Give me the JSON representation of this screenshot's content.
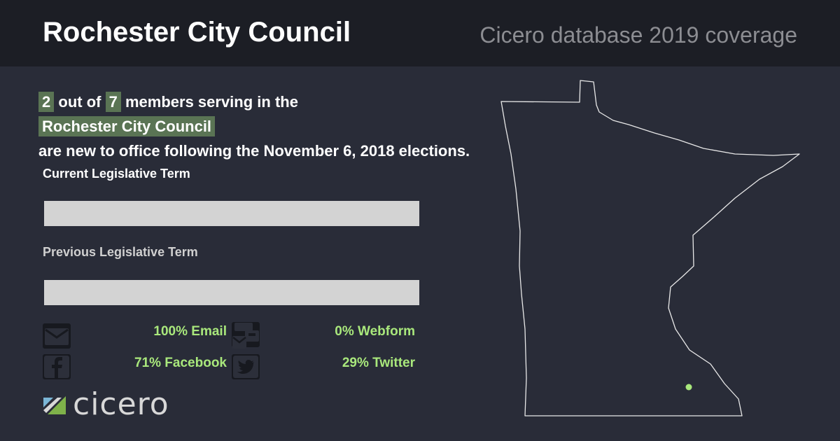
{
  "header": {
    "title": "Rochester City Council",
    "subtitle": "Cicero database 2019 coverage"
  },
  "summary": {
    "new_count": "2",
    "out_of": "out of",
    "total_count": "7",
    "members_text": "members serving in the",
    "body_name": "Rochester City Council",
    "tail_text": "are new to office following the November 6, 2018 elections."
  },
  "terms": {
    "current_label": "Current Legislative Term",
    "previous_label": "Previous Legislative Term"
  },
  "contact_stats": {
    "email": "100% Email",
    "webform": "0% Webform",
    "facebook": "71% Facebook",
    "twitter": "29% Twitter"
  },
  "icons": {
    "email": "envelope-icon",
    "webform": "webform-icon",
    "facebook": "facebook-icon",
    "twitter": "twitter-icon",
    "map_marker": "location-dot"
  },
  "logo": {
    "wordmark": "cicero"
  },
  "colors": {
    "background": "#292c38",
    "header": "#1c1e25",
    "highlight": "#5a7454",
    "accent": "#a9e87c",
    "bar": "#d3d3d3"
  }
}
